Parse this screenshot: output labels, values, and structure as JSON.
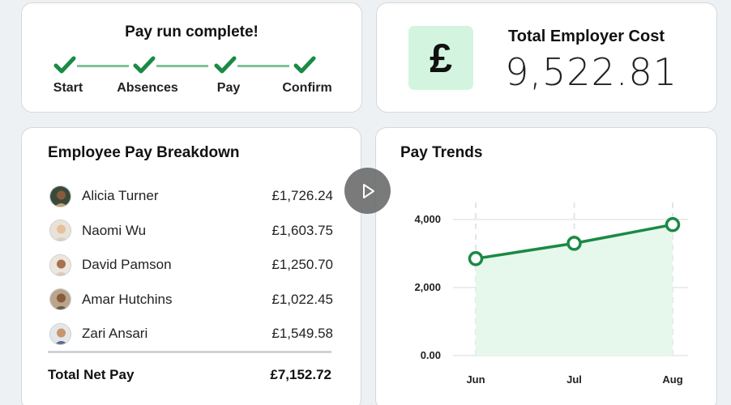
{
  "payrun": {
    "title": "Pay run complete!",
    "steps": [
      "Start",
      "Absences",
      "Pay",
      "Confirm"
    ]
  },
  "cost": {
    "icon": "pound-icon",
    "symbol": "£",
    "label": "Total Employer Cost",
    "value": "9,522.81"
  },
  "breakdown": {
    "title": "Employee Pay Breakdown",
    "employees": [
      {
        "name": "Alicia Turner",
        "amount": "£1,726.24"
      },
      {
        "name": "Naomi Wu",
        "amount": "£1,603.75"
      },
      {
        "name": "David Pamson",
        "amount": "£1,250.70"
      },
      {
        "name": "Amar Hutchins",
        "amount": "£1,022.45"
      },
      {
        "name": "Zari Ansari",
        "amount": "£1,549.58"
      }
    ],
    "total_label": "Total Net Pay",
    "total_amount": "£7,152.72"
  },
  "play": {
    "icon": "play-icon"
  },
  "colors": {
    "accent": "#1a8a44",
    "accent_light": "#d3f5df",
    "area_fill": "#e6f8ec"
  },
  "chart_data": {
    "type": "area",
    "title": "Pay Trends",
    "categories": [
      "Jun",
      "Jul",
      "Aug"
    ],
    "series": [
      {
        "values": [
          2850,
          3300,
          3850
        ]
      }
    ],
    "y_ticks": [
      "0.00",
      "2,000",
      "4,000"
    ],
    "ylim": [
      0,
      4000
    ],
    "grid": true
  }
}
